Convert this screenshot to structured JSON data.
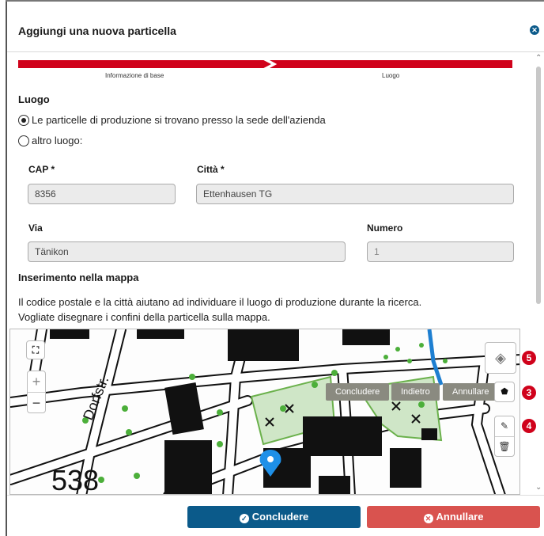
{
  "modal": {
    "title": "Aggiungi una nuova particella",
    "close_icon": "close-circle-icon"
  },
  "stepper": {
    "steps": [
      {
        "label": "Informazione di base",
        "done": true
      },
      {
        "label": "Luogo",
        "active": true
      }
    ],
    "color": "#d0021b"
  },
  "location": {
    "title": "Luogo",
    "options": [
      {
        "label": "Le particelle di produzione si trovano presso la sede dell'azienda",
        "selected": true
      },
      {
        "label": "altro luogo:",
        "selected": false
      }
    ]
  },
  "address": {
    "cap_label": "CAP *",
    "cap_value": "8356",
    "city_label": "Città *",
    "city_value": "Ettenhausen TG",
    "street_label": "Via",
    "street_value": "Tänikon",
    "number_label": "Numero",
    "number_placeholder": "1"
  },
  "map_section": {
    "title": "Inserimento nella mappa",
    "help_line1": "Il codice postale e la città aiutano ad individuare il luogo di produzione durante la ricerca.",
    "help_line2": "Vogliate disegnare i confini della particella sulla mappa.",
    "map_labels": {
      "street": "Dorfstr.",
      "number": "538"
    },
    "controls": {
      "fullscreen_icon": "fullscreen-icon",
      "zoom_in": "+",
      "zoom_out": "−",
      "layers_icon": "layers-icon",
      "polygon_icon": "polygon-icon",
      "edit_icon": "edit-icon",
      "delete_icon": "trash-icon"
    },
    "draw_actions": {
      "finish": "Concludere",
      "back": "Indietro",
      "cancel": "Annullare"
    },
    "badges": [
      "5",
      "3",
      "4"
    ]
  },
  "footer": {
    "confirm_label": "Concludere",
    "cancel_label": "Annullare",
    "confirm_color": "#0b5a8a",
    "cancel_color": "#d9534f"
  }
}
